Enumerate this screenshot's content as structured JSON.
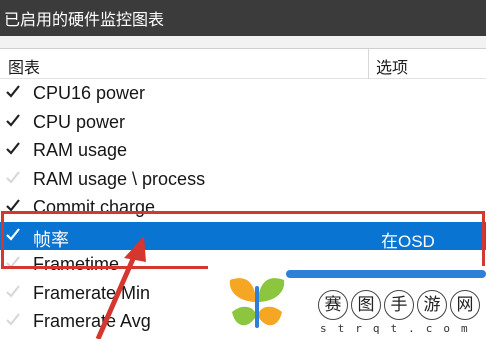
{
  "window": {
    "title": "已启用的硬件监控图表"
  },
  "list": {
    "columns": [
      "图表",
      "选项"
    ],
    "rows": [
      {
        "label": "CPU16 power",
        "checked": true,
        "option": ""
      },
      {
        "label": "CPU power",
        "checked": true,
        "option": ""
      },
      {
        "label": "RAM usage",
        "checked": true,
        "option": ""
      },
      {
        "label": "RAM usage \\ process",
        "checked": false,
        "option": ""
      },
      {
        "label": "Commit charge",
        "checked": true,
        "option": ""
      },
      {
        "label": "帧率",
        "checked": true,
        "option": "在OSD",
        "selected": true
      },
      {
        "label": "Frametime",
        "checked": false,
        "option": ""
      },
      {
        "label": "Framerate Min",
        "checked": false,
        "option": ""
      },
      {
        "label": "Framerate Avg",
        "checked": false,
        "option": ""
      }
    ]
  },
  "watermark": {
    "chars": [
      "赛",
      "图",
      "手",
      "游",
      "网"
    ],
    "sub": "strqt.com"
  },
  "colors": {
    "selection": "#0a74d2",
    "highlight_box": "#d4372f",
    "titlebar": "#3b3b3b"
  }
}
